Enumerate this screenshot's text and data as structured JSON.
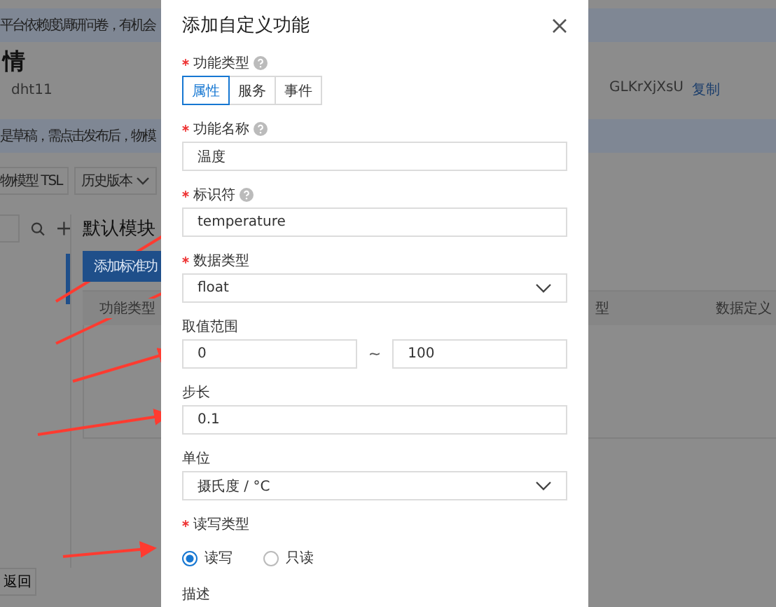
{
  "background": {
    "banner": "平台依赖度调研问卷，有机会",
    "page_title": "情",
    "product_name": "dht11",
    "secret_fragment": "GLKrXjXsU",
    "copy_link": "复制",
    "draft_notice": "是草稿，需点击发布后，物模",
    "toolbar_buttons": [
      {
        "label": "物模型 TSL",
        "kind": "plain"
      },
      {
        "label": "历史版本",
        "kind": "dropdown"
      }
    ],
    "module_title": "默认模块",
    "add_button": "添加标准功",
    "table_columns": [
      "功能类型",
      "型",
      "数据定义"
    ],
    "back_button": "返回"
  },
  "dialog": {
    "title": "添加自定义功能",
    "fields": [
      {
        "kind": "segmented",
        "label": "功能类型",
        "required": true,
        "help": true,
        "options": [
          {
            "label": "属性",
            "selected": true
          },
          {
            "label": "服务",
            "selected": false
          },
          {
            "label": "事件",
            "selected": false
          }
        ]
      },
      {
        "kind": "input",
        "label": "功能名称",
        "required": true,
        "help": true,
        "value": "温度"
      },
      {
        "kind": "input",
        "label": "标识符",
        "required": true,
        "help": true,
        "value": "temperature"
      },
      {
        "kind": "select",
        "label": "数据类型",
        "required": true,
        "help": false,
        "value": "float"
      },
      {
        "kind": "range",
        "label": "取值范围",
        "required": false,
        "help": false,
        "min": "0",
        "separator": "~",
        "max": "100"
      },
      {
        "kind": "input",
        "label": "步长",
        "required": false,
        "help": false,
        "value": "0.1"
      },
      {
        "kind": "select",
        "label": "单位",
        "required": false,
        "help": false,
        "value": "摄氏度 / °C"
      },
      {
        "kind": "radio",
        "label": "读写类型",
        "required": true,
        "help": false,
        "options": [
          {
            "label": "读写",
            "selected": true
          },
          {
            "label": "只读",
            "selected": false
          }
        ]
      },
      {
        "kind": "textarea",
        "label": "描述",
        "required": false,
        "help": false
      }
    ]
  }
}
